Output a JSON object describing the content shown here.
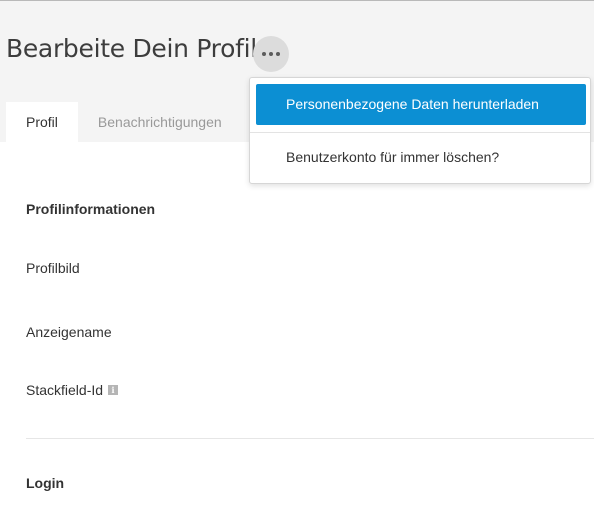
{
  "header": {
    "title": "Bearbeite Dein Profil",
    "more_icon": "more-horizontal-icon"
  },
  "tabs": [
    {
      "label": "Profil",
      "active": true
    },
    {
      "label": "Benachrichtigungen",
      "active": false
    }
  ],
  "dropdown": {
    "items": [
      {
        "label": "Personenbezogene Daten herunterladen",
        "highlighted": true
      },
      {
        "label": "Benutzerkonto für immer löschen?",
        "highlighted": false
      }
    ],
    "highlight_color": "#0c8fd3"
  },
  "profile_section": {
    "heading": "Profilinformationen",
    "fields": [
      {
        "label": "Profilbild"
      },
      {
        "label": "Anzeigename"
      },
      {
        "label": "Stackfield-Id",
        "info_icon": "info-icon"
      }
    ]
  },
  "login_section": {
    "heading": "Login"
  }
}
